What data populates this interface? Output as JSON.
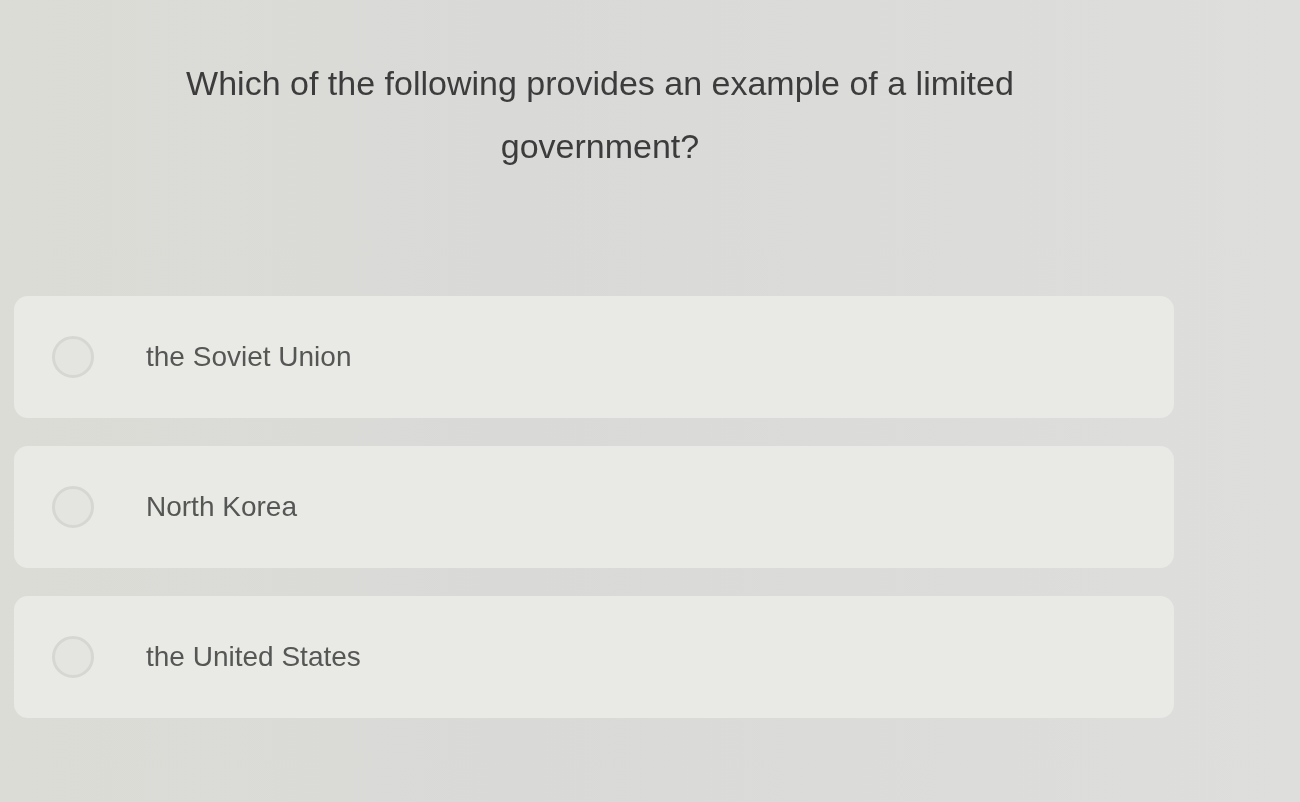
{
  "question": {
    "text": "Which of the following provides an example of a limited government?"
  },
  "options": [
    {
      "label": "the Soviet Union",
      "selected": false
    },
    {
      "label": "North Korea",
      "selected": false
    },
    {
      "label": "the United States",
      "selected": false
    }
  ]
}
